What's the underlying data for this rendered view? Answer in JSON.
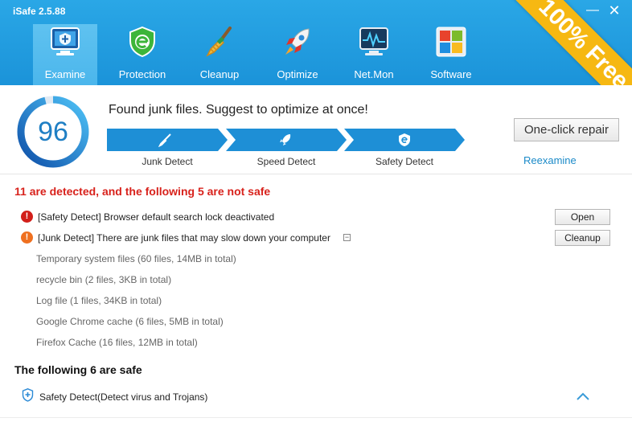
{
  "window": {
    "title": "iSafe 2.5.88",
    "minimize": "—",
    "close": "✕"
  },
  "nav": {
    "tabs": [
      {
        "label": "Examine",
        "icon": "monitor-cross-icon"
      },
      {
        "label": "Protection",
        "icon": "shield-e-icon"
      },
      {
        "label": "Cleanup",
        "icon": "broom-icon"
      },
      {
        "label": "Optimize",
        "icon": "rocket-icon"
      },
      {
        "label": "Net.Mon",
        "icon": "network-monitor-icon"
      },
      {
        "label": "Software",
        "icon": "windows-logo-icon"
      }
    ],
    "active_tab": "Examine"
  },
  "banner": {
    "text": "100% Free",
    "color": "#f6b812"
  },
  "summary": {
    "score": "96",
    "score_fraction": 0.96,
    "message": "Found junk files. Suggest to optimize at once!",
    "stages": [
      {
        "label": "Junk Detect",
        "icon": "broom-icon"
      },
      {
        "label": "Speed Detect",
        "icon": "rocket-icon"
      },
      {
        "label": "Safety Detect",
        "icon": "shield-e-icon"
      }
    ],
    "repair_button": "One-click repair",
    "reexamine_link": "Reexamine"
  },
  "results": {
    "headline": "11  are detected, and the following 5 are not safe",
    "issues": [
      {
        "text": "[Safety Detect] Browser default search lock deactivated",
        "badge": "!",
        "badge_color": "#d21f1a",
        "action": "Open"
      },
      {
        "text": "[Junk Detect] There are junk files that may slow down your computer",
        "badge": "!",
        "badge_color": "#ef7020",
        "action": "Cleanup",
        "toggle": "−"
      }
    ],
    "junk_items": [
      "Temporary system files (60 files, 14MB in total)",
      "recycle bin (2 files, 3KB in total)",
      "Log file (1 files, 34KB in total)",
      "Google Chrome cache (6 files, 5MB in total)",
      "Firefox Cache (16 files, 12MB in total)"
    ],
    "safe_headline": "The following 6 are safe",
    "safe_items": [
      {
        "text": "Safety Detect(Detect virus and Trojans)",
        "icon": "shield-plus-icon"
      }
    ]
  },
  "colors": {
    "header_blue": "#1b93d9",
    "accent_blue": "#1f7fc4",
    "alert_red": "#d8221c",
    "warning_orange": "#ef7020"
  }
}
